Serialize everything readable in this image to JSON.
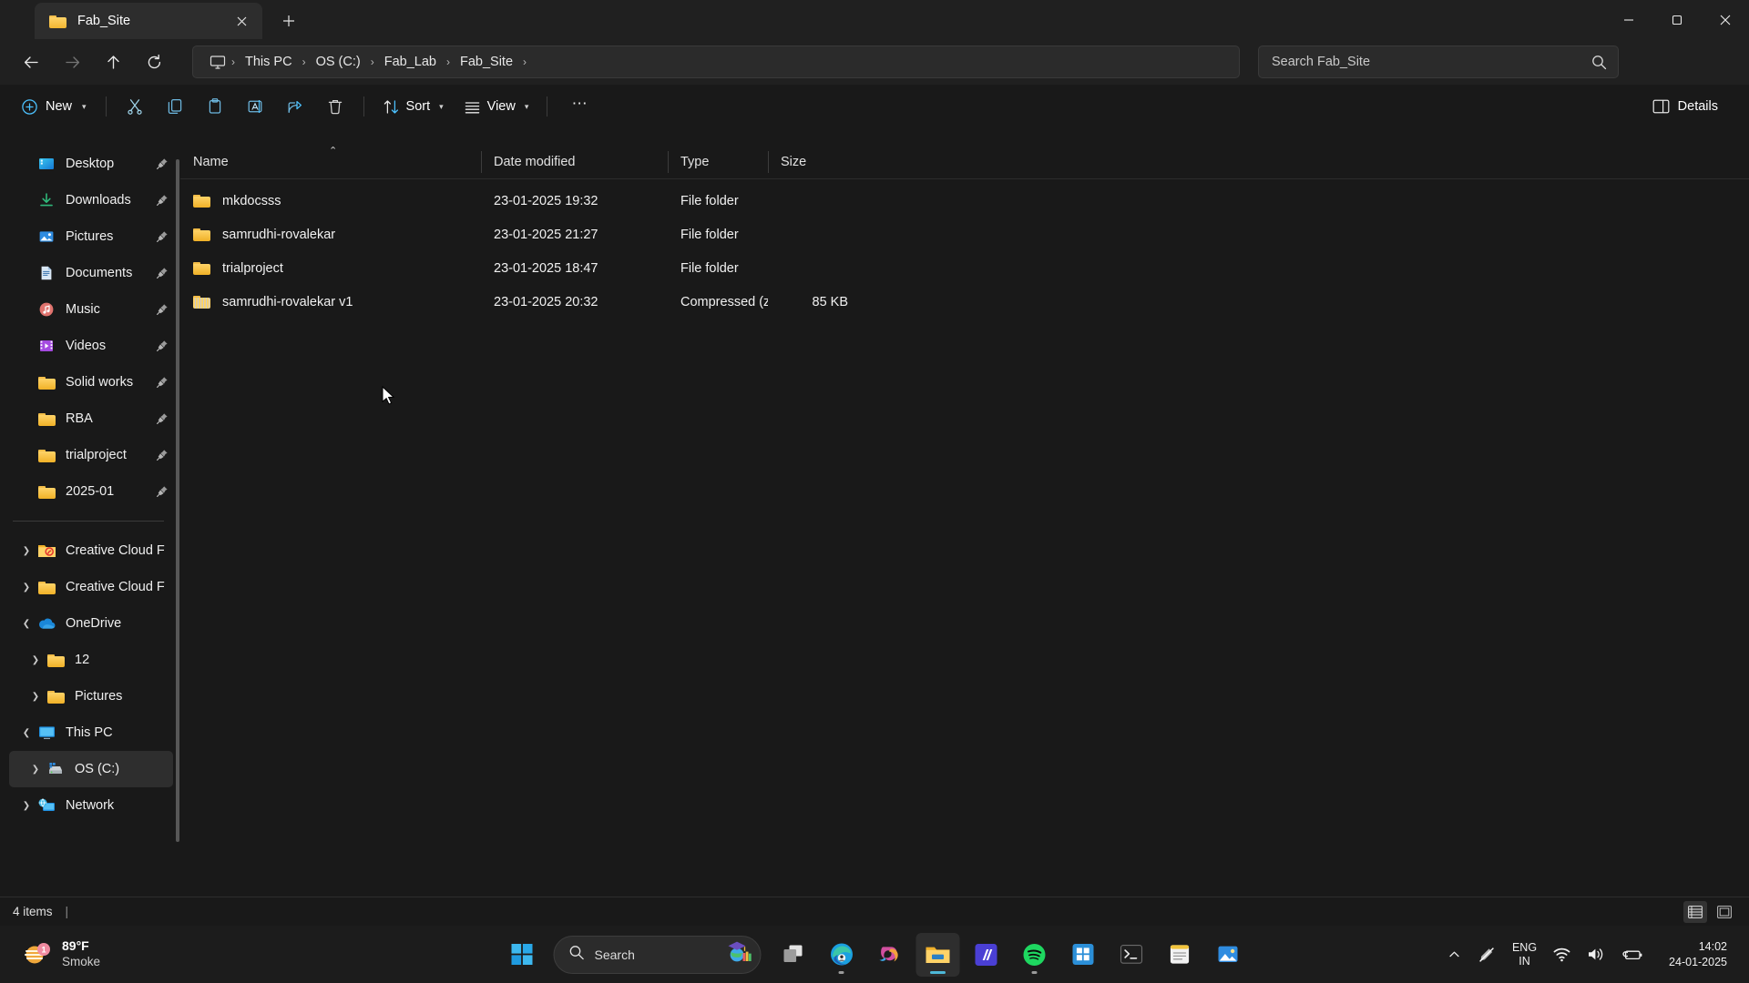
{
  "window": {
    "tab_title": "Fab_Site",
    "tab_icon": "folder-icon",
    "close_tab_icon": "close-icon",
    "new_tab_icon": "plus-icon",
    "minimize_icon": "minimize-icon",
    "maximize_icon": "maximize-icon",
    "close_icon": "close-icon"
  },
  "nav": {
    "back_icon": "arrow-left-icon",
    "forward_icon": "arrow-right-icon",
    "up_icon": "arrow-up-icon",
    "refresh_icon": "refresh-icon",
    "breadcrumb_icon": "monitor-icon",
    "breadcrumbs": [
      "This PC",
      "OS (C:)",
      "Fab_Lab",
      "Fab_Site"
    ],
    "separator": "›",
    "search_placeholder": "Search Fab_Site",
    "search_value": "",
    "search_icon": "search-icon"
  },
  "toolbar": {
    "new_label": "New",
    "new_icon": "plus-circle-icon",
    "cut_icon": "scissors-icon",
    "copy_icon": "copy-icon",
    "paste_icon": "paste-icon",
    "rename_icon": "rename-icon",
    "share_icon": "share-icon",
    "delete_icon": "trash-icon",
    "sort_label": "Sort",
    "sort_icon": "sort-arrows-icon",
    "view_label": "View",
    "view_icon": "list-lines-icon",
    "more_icon": "ellipsis-icon",
    "details_label": "Details",
    "details_icon": "details-pane-icon",
    "chevron": "⌄"
  },
  "sidebar": {
    "quick_access": [
      {
        "label": "Desktop",
        "icon": "desktop-icon",
        "pinned": true
      },
      {
        "label": "Downloads",
        "icon": "download-icon",
        "pinned": true
      },
      {
        "label": "Pictures",
        "icon": "pictures-icon",
        "pinned": true
      },
      {
        "label": "Documents",
        "icon": "documents-icon",
        "pinned": true
      },
      {
        "label": "Music",
        "icon": "music-icon",
        "pinned": true
      },
      {
        "label": "Videos",
        "icon": "videos-icon",
        "pinned": true
      },
      {
        "label": "Solid works",
        "icon": "folder-icon",
        "pinned": true
      },
      {
        "label": "RBA",
        "icon": "folder-icon",
        "pinned": true
      },
      {
        "label": "trialproject",
        "icon": "folder-icon",
        "pinned": true
      },
      {
        "label": "2025-01",
        "icon": "folder-icon",
        "pinned": true
      }
    ],
    "tree": [
      {
        "label": "Creative Cloud F",
        "icon": "creative-cloud-folder-icon",
        "twisty": "›",
        "indent": 0,
        "selected": false
      },
      {
        "label": "Creative Cloud F",
        "icon": "folder-icon",
        "twisty": "›",
        "indent": 0,
        "selected": false
      },
      {
        "label": "OneDrive",
        "icon": "onedrive-icon",
        "twisty": "⌄",
        "indent": 0,
        "selected": false
      },
      {
        "label": "12",
        "icon": "folder-icon",
        "twisty": "›",
        "indent": 1,
        "selected": false
      },
      {
        "label": "Pictures",
        "icon": "folder-icon",
        "twisty": "›",
        "indent": 1,
        "selected": false
      },
      {
        "label": "This PC",
        "icon": "monitor-icon",
        "twisty": "⌄",
        "indent": 0,
        "selected": false
      },
      {
        "label": "OS (C:)",
        "icon": "drive-icon",
        "twisty": "›",
        "indent": 1,
        "selected": true
      },
      {
        "label": "Network",
        "icon": "network-icon",
        "twisty": "›",
        "indent": 0,
        "selected": false
      }
    ]
  },
  "filelist": {
    "columns": [
      "Name",
      "Date modified",
      "Type",
      "Size"
    ],
    "sort_caret": "⌃",
    "rows": [
      {
        "name": "mkdocsss",
        "date": "23-01-2025 19:32",
        "type": "File folder",
        "size": "",
        "icon": "folder-icon"
      },
      {
        "name": "samrudhi-rovalekar",
        "date": "23-01-2025 21:27",
        "type": "File folder",
        "size": "",
        "icon": "folder-icon"
      },
      {
        "name": "trialproject",
        "date": "23-01-2025 18:47",
        "type": "File folder",
        "size": "",
        "icon": "folder-icon"
      },
      {
        "name": "samrudhi-rovalekar v1",
        "date": "23-01-2025 20:32",
        "type": "Compressed (zipp…)",
        "size": "85 KB",
        "icon": "zip-icon"
      }
    ]
  },
  "status": {
    "item_count": "4 items",
    "separator": "|",
    "details_view_icon": "details-view-icon",
    "large_icons_view_icon": "large-icons-view-icon"
  },
  "taskbar": {
    "weather": {
      "temperature": "89°F",
      "condition": "Smoke",
      "badge": "1",
      "icon": "smoke-weather-icon"
    },
    "start_icon": "windows-start-icon",
    "search_placeholder": "Search",
    "search_icon": "search-icon",
    "search_widget_icon": "graduation-books-icon",
    "apps": [
      {
        "name": "task-view",
        "icon": "task-view-icon",
        "running": false,
        "active": false
      },
      {
        "name": "edge",
        "icon": "edge-icon",
        "running": true,
        "active": false
      },
      {
        "name": "copilot",
        "icon": "copilot-icon",
        "running": false,
        "active": false
      },
      {
        "name": "file-explorer",
        "icon": "file-explorer-icon",
        "running": true,
        "active": true
      },
      {
        "name": "autodesk",
        "icon": "autodesk-icon",
        "running": false,
        "active": false
      },
      {
        "name": "spotify",
        "icon": "spotify-icon",
        "running": true,
        "active": false
      },
      {
        "name": "store",
        "icon": "microsoft-store-icon",
        "running": false,
        "active": false
      },
      {
        "name": "terminal",
        "icon": "terminal-icon",
        "running": false,
        "active": false
      },
      {
        "name": "notepad",
        "icon": "notepad-icon",
        "running": false,
        "active": false
      },
      {
        "name": "photos",
        "icon": "photos-icon",
        "running": false,
        "active": false
      }
    ],
    "tray": {
      "overflow_icon": "chevron-up-icon",
      "pen_icon": "pen-disabled-icon",
      "language_line1": "ENG",
      "language_line2": "IN",
      "wifi_icon": "wifi-icon",
      "volume_icon": "speaker-icon",
      "battery_icon": "battery-icon",
      "time": "14:02",
      "date": "24-01-2025"
    }
  },
  "colors": {
    "window_bg": "#191919",
    "chrome_bg": "#202020",
    "tab_bg": "#2d2d2d",
    "accent_blue": "#4cc2ff",
    "folder_yellow": "#ffd368",
    "selection": "#2e2e2e"
  }
}
